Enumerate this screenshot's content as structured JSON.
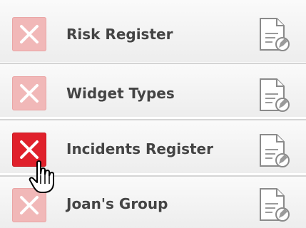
{
  "items": [
    {
      "label": "Risk Register",
      "delete_icon": "close-icon",
      "edit_icon": "edit-document-icon",
      "active": false
    },
    {
      "label": "Widget Types",
      "delete_icon": "close-icon",
      "edit_icon": "edit-document-icon",
      "active": false
    },
    {
      "label": "Incidents Register",
      "delete_icon": "close-icon",
      "edit_icon": "edit-document-icon",
      "active": true
    },
    {
      "label": "Joan's Group",
      "delete_icon": "close-icon",
      "edit_icon": "edit-document-icon",
      "active": false
    }
  ],
  "colors": {
    "delete_idle": "#f1b8b8",
    "delete_active": "#e0202b",
    "label": "#444444",
    "row_border": "#d5d5d5"
  },
  "cursor_icon": "hand-pointer-icon"
}
